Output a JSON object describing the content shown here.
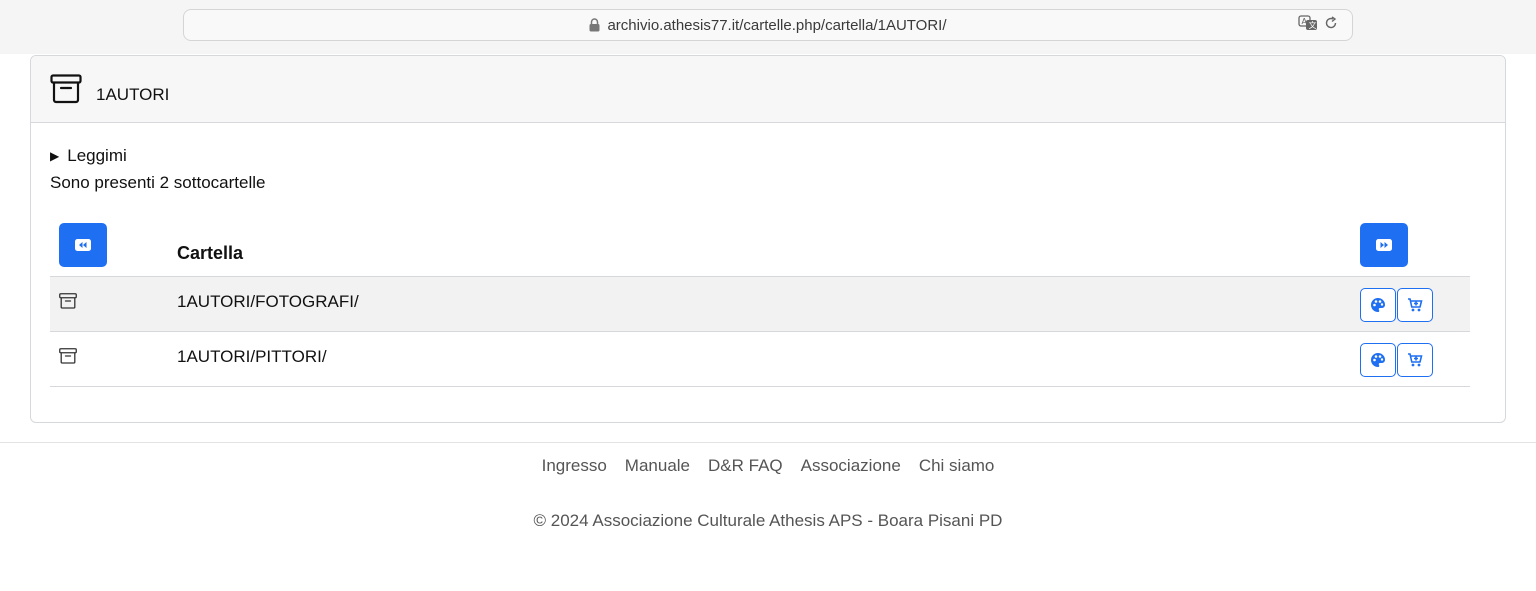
{
  "browser": {
    "url": "archivio.athesis77.it/cartelle.php/cartella/1AUTORI/",
    "lock_icon": "lock-icon",
    "translate_icon": "translate-icon",
    "reload_icon": "reload-icon"
  },
  "card": {
    "title": "1AUTORI",
    "header_icon": "archive-box-icon",
    "details_summary": "Leggimi",
    "subfolder_count_text": "Sono presenti 2 sottocartelle"
  },
  "table": {
    "column_header": "Cartella",
    "prev_icon": "rewind-icon",
    "next_icon": "fast-forward-icon",
    "rows": [
      {
        "label": "1AUTORI/FOTOGRAFI/",
        "icon": "archive-box-icon",
        "actions": [
          "palette-icon",
          "cart-add-icon"
        ]
      },
      {
        "label": "1AUTORI/PITTORI/",
        "icon": "archive-box-icon",
        "actions": [
          "palette-icon",
          "cart-add-icon"
        ]
      }
    ]
  },
  "colors": {
    "primary": "#1f6ff2",
    "footer_text": "#555555"
  },
  "footer": {
    "links": [
      "Ingresso",
      "Manuale",
      "D&R FAQ",
      "Associazione",
      "Chi siamo"
    ],
    "copyright": "© 2024 Associazione Culturale Athesis APS - Boara Pisani PD"
  }
}
